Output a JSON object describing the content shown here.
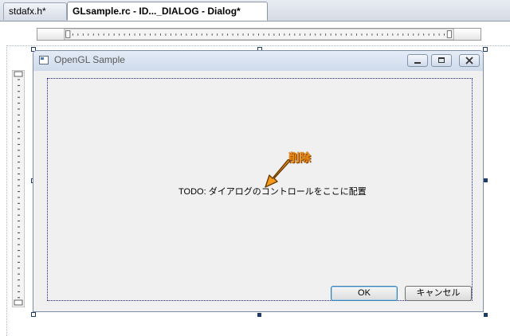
{
  "tabs": [
    {
      "label": "stdafx.h*",
      "active": false
    },
    {
      "label": "GLsample.rc - ID..._DIALOG - Dialog*",
      "active": true
    }
  ],
  "dialog": {
    "title": "OpenGL Sample",
    "caption_buttons": {
      "minimize": "minimize-icon",
      "maximize": "maximize-icon",
      "close": "close-icon"
    },
    "todo_text": "TODO: ダイアログのコントロールをここに配置",
    "ok_label": "OK",
    "cancel_label": "キャンセル"
  },
  "annotation": {
    "label": "削除",
    "color": "#f08c10"
  }
}
